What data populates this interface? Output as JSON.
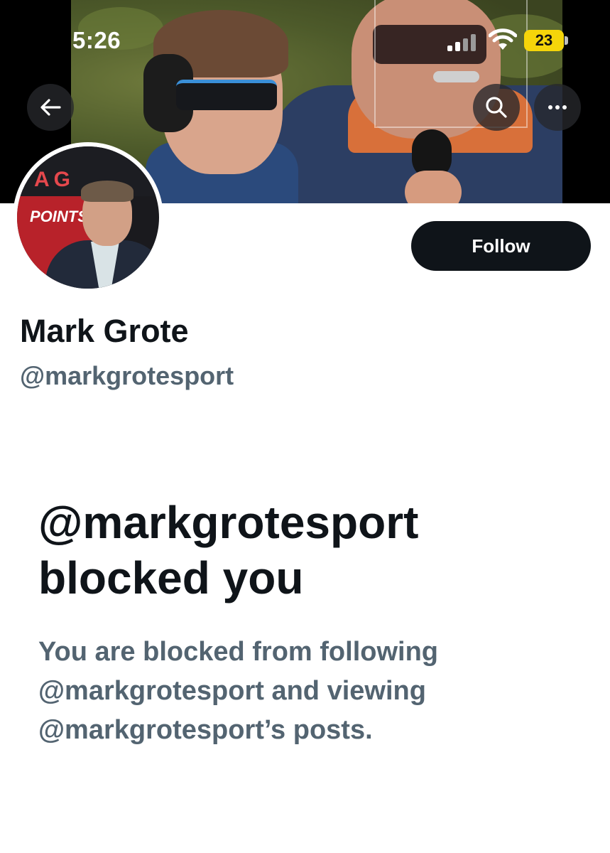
{
  "status_bar": {
    "time": "5:26",
    "battery_level": "23",
    "icons": [
      "cellular-signal-icon",
      "wifi-icon",
      "battery-icon"
    ]
  },
  "header": {
    "back_icon": "arrow-left-icon",
    "search_icon": "search-icon",
    "more_icon": "more-horizontal-icon"
  },
  "profile": {
    "display_name": "Mark Grote",
    "handle": "@markgrotesport",
    "follow_label": "Follow",
    "avatar_text_top": "AG",
    "avatar_text_points": "POINTS"
  },
  "blocked_notice": {
    "title_line1": "@markgrotesport",
    "title_line2": "blocked you",
    "desc_line1": "You are blocked from following",
    "desc_line2": "@markgrotesport and viewing",
    "desc_line3": "@markgrotesport’s posts."
  },
  "colors": {
    "text_primary": "#0f1419",
    "text_secondary": "#536471",
    "button_dark": "#0f1419",
    "battery": "#f5d50a"
  }
}
